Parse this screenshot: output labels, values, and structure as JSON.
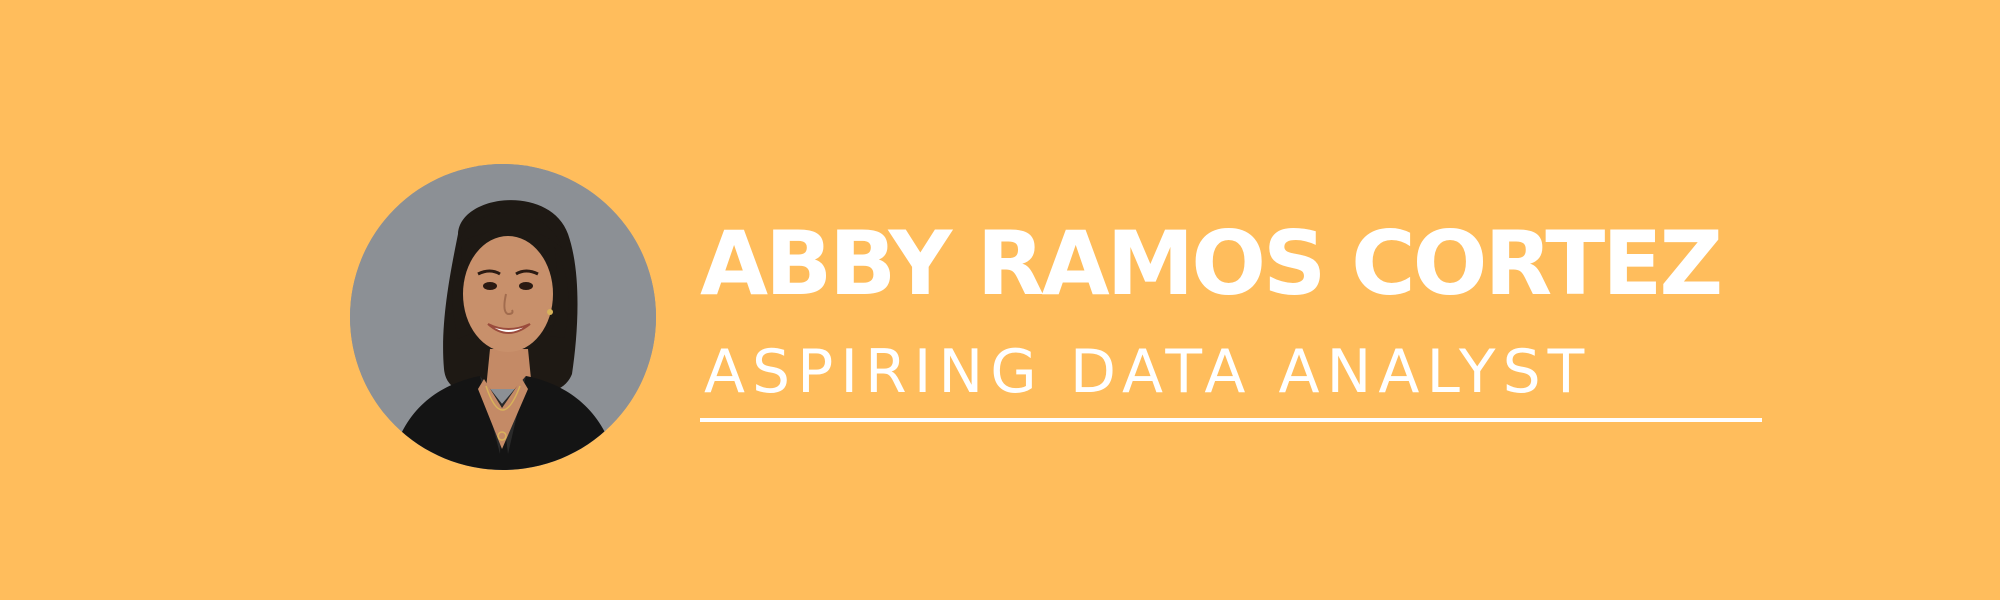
{
  "banner": {
    "name": "ABBY RAMOS CORTEZ",
    "title": "ASPIRING DATA ANALYST",
    "background_color": "#FFBD5C",
    "text_color": "#FFFFFF"
  },
  "avatar": {
    "icon": "profile-photo",
    "background_color": "#8C9095"
  }
}
